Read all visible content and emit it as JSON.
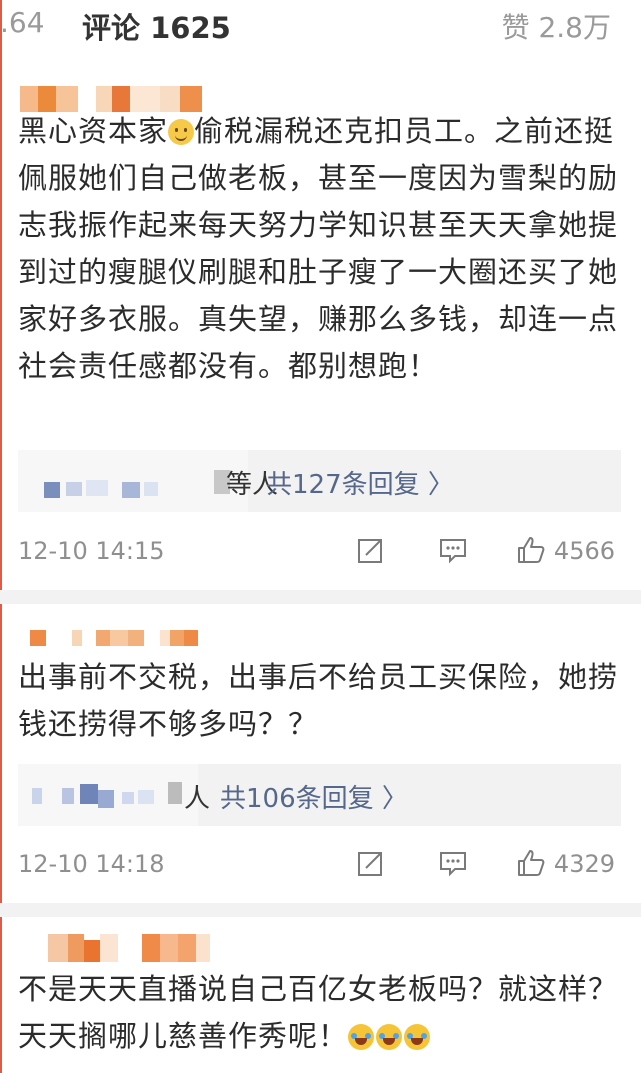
{
  "header": {
    "partial_left": ".64",
    "title": "评论 1625",
    "likes": "赞 2.8万"
  },
  "comments": [
    {
      "text": "黑心资本家",
      "text2": "偷税漏税还克扣员工。之前还挺佩服她们自己做老板，甚至一度因为雪梨的励志我振作起来每天努力学知识甚至天天拿她提到过的瘦腿仪刷腿和肚子瘦了一大圈还买了她家好多衣服。真失望，赚那么多钱，却连一点社会责任感都没有。都别想跑！",
      "reply_suffix": "等人",
      "reply_count": "共127条回复 〉",
      "time": "12-10 14:15",
      "likes": "4566"
    },
    {
      "text": "出事前不交税，出事后不给员工买保险，她捞钱还捞得不够多吗？？",
      "reply_suffix": "人",
      "reply_count": "共106条回复 〉",
      "time": "12-10 14:18",
      "likes": "4329"
    },
    {
      "text": "不是天天直播说自己百亿女老板吗？就这样？天天搁哪儿慈善作秀呢！"
    }
  ],
  "icons": {
    "smile": "smile-emoji-icon",
    "laugh": "laugh-cry-emoji-icon",
    "repost": "repost-icon",
    "comment": "comment-icon",
    "like": "thumbs-up-icon"
  }
}
